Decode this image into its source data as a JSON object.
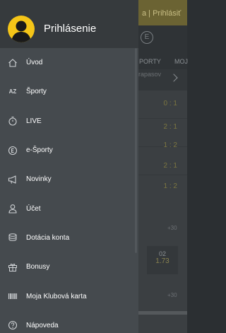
{
  "background": {
    "topbar_text": "a | Prihlásiť",
    "nav_label_1": "PORTY",
    "nav_label_2": "MOJ",
    "subbar_text": "rapasov",
    "scores": [
      "0 : 1",
      "2 : 1",
      "1 : 2",
      "2 : 1",
      "1 : 2"
    ],
    "small_labels": [
      "+30",
      "+30"
    ],
    "odd_box": {
      "label": "02",
      "value": "1.73"
    }
  },
  "drawer": {
    "login_label": "Prihlásenie",
    "items": [
      {
        "label": "Úvod",
        "icon": "home-icon"
      },
      {
        "label": "Športy",
        "icon": "az-icon",
        "icon_text": "AZ"
      },
      {
        "label": "LIVE",
        "icon": "stopwatch-icon"
      },
      {
        "label": "e-Športy",
        "icon": "esports-icon"
      },
      {
        "label": "Novinky",
        "icon": "megaphone-icon"
      },
      {
        "label": "Účet",
        "icon": "user-icon"
      },
      {
        "label": "Dotácia konta",
        "icon": "coins-icon"
      },
      {
        "label": "Bonusy",
        "icon": "gift-icon"
      },
      {
        "label": "Moja Klubová karta",
        "icon": "barcode-icon"
      },
      {
        "label": "Nápoveda",
        "icon": "help-icon"
      }
    ]
  },
  "colors": {
    "accent": "#f5c518",
    "drawer_bg": "#454a4e",
    "header_bg": "#363a3d"
  }
}
